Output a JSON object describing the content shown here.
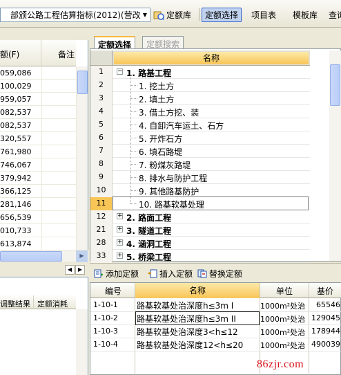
{
  "toolbar": {
    "combo_text": "部颁公路工程估算指标(2012)(营改",
    "btn_quota_lib": "定额库",
    "btn_quota_select": "定额选择",
    "btn_project": "项目表",
    "btn_template": "模板库",
    "btn_query": "查询"
  },
  "left_grid": {
    "col_amount": "额(F)",
    "col_note": "备注",
    "values": [
      "059,086",
      "100,029",
      "959,057",
      "082,537",
      "082,537",
      "320,557",
      "761,980",
      "746,067",
      "379,942",
      "366,125",
      "281,146",
      "656,539",
      "010,733",
      "613,874"
    ]
  },
  "left_bottom": {
    "col_adjust": "调整结果",
    "col_consume": "定额消耗"
  },
  "tabs": {
    "select": "定额选择",
    "search": "定额搜索"
  },
  "tree": {
    "header_name": "名称",
    "rows": [
      {
        "num": "1",
        "label": "1. 路基工程",
        "bold": true,
        "level": 0,
        "box": "−"
      },
      {
        "num": "2",
        "label": "1. 挖土方",
        "bold": false,
        "level": 1
      },
      {
        "num": "3",
        "label": "2. 填土方",
        "bold": false,
        "level": 1
      },
      {
        "num": "4",
        "label": "3. 借土方挖、装",
        "bold": false,
        "level": 1
      },
      {
        "num": "5",
        "label": "4. 自卸汽车运土、石方",
        "bold": false,
        "level": 1
      },
      {
        "num": "6",
        "label": "5. 开炸石方",
        "bold": false,
        "level": 1
      },
      {
        "num": "7",
        "label": "6. 填石路堤",
        "bold": false,
        "level": 1
      },
      {
        "num": "8",
        "label": "7. 粉煤灰路堤",
        "bold": false,
        "level": 1
      },
      {
        "num": "9",
        "label": "8. 排水与防护工程",
        "bold": false,
        "level": 1
      },
      {
        "num": "10",
        "label": "9. 其他路基防护",
        "bold": false,
        "level": 1
      },
      {
        "num": "11",
        "label": "10. 路基软基处理",
        "bold": false,
        "level": 1,
        "selected": true
      },
      {
        "num": "12",
        "label": "2. 路面工程",
        "bold": true,
        "level": 0,
        "box": "+"
      },
      {
        "num": "21",
        "label": "3. 隧道工程",
        "bold": true,
        "level": 0,
        "box": "+"
      },
      {
        "num": "28",
        "label": "4. 涵洞工程",
        "bold": true,
        "level": 0,
        "box": "+"
      },
      {
        "num": "33",
        "label": "5. 桥梁工程",
        "bold": true,
        "level": 0,
        "box": "+"
      }
    ]
  },
  "actions": {
    "add": "添加定额",
    "insert": "插入定额",
    "replace": "替换定额"
  },
  "quota_table": {
    "headers": {
      "code": "编号",
      "name": "名称",
      "unit": "单位",
      "price": "基价"
    },
    "rows": [
      {
        "code": "1-10-1",
        "name": "路基软基处治深度h≤3m I",
        "unit": "1000m²处治",
        "price": "65546"
      },
      {
        "code": "1-10-2",
        "name": "路基软基处治深度h≤3m II",
        "unit": "1000m²处治",
        "price": "129045",
        "selected": true
      },
      {
        "code": "1-10-3",
        "name": "路基软基处治深度3<h≤12",
        "unit": "1000m²处治",
        "price": "178944"
      },
      {
        "code": "1-10-4",
        "name": "路基软基处治深度12<h≤20",
        "unit": "1000m²处治",
        "price": "490039"
      }
    ]
  },
  "watermark": "86zjr.com"
}
